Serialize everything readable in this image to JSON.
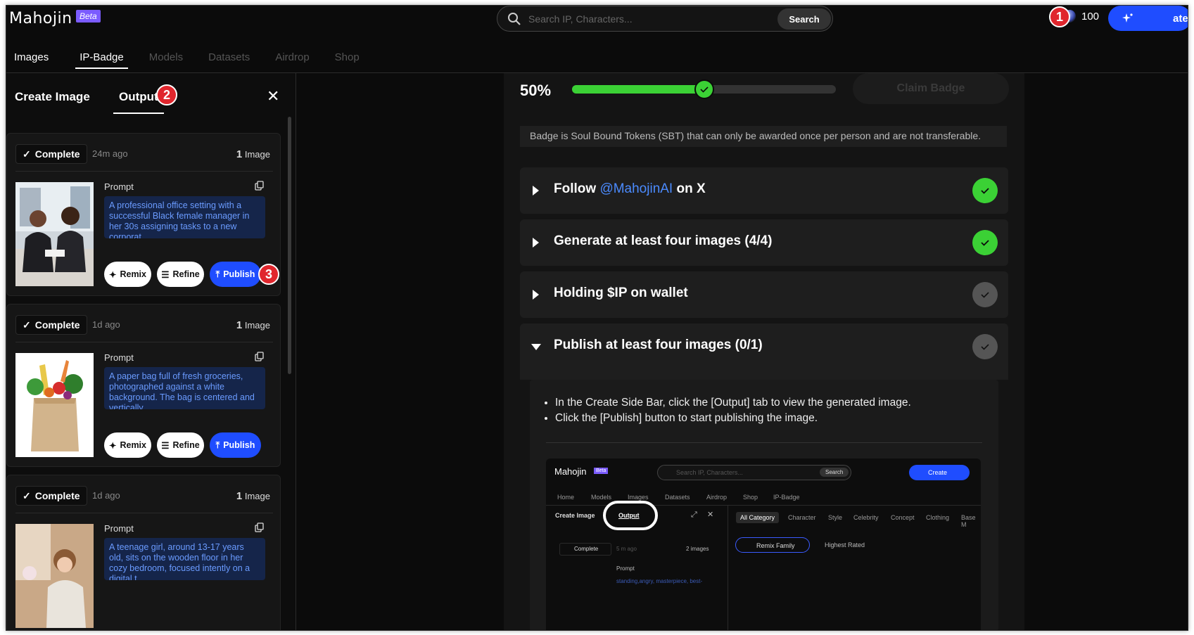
{
  "app": {
    "logo": "Mahojin",
    "beta": "Beta"
  },
  "search": {
    "placeholder": "Search IP, Characters...",
    "button": "Search"
  },
  "credits": "100",
  "create_button": "Create",
  "annotations": {
    "one": "1",
    "two": "2",
    "three": "3"
  },
  "nav": {
    "tabs": [
      {
        "label": "Images"
      },
      {
        "label": "IP-Badge"
      },
      {
        "label": "Models"
      },
      {
        "label": "Datasets"
      },
      {
        "label": "Airdrop"
      },
      {
        "label": "Shop"
      }
    ]
  },
  "sidebar": {
    "tab_create": "Create Image",
    "tab_output": "Output",
    "cards": [
      {
        "status": "Complete",
        "ago": "24m ago",
        "count_num": "1",
        "count_word": "Image",
        "prompt_label": "Prompt",
        "prompt": "A professional office setting with a successful Black female manager in her 30s assigning tasks to a new corporat...",
        "remix": "Remix",
        "refine": "Refine",
        "publish": "Publish"
      },
      {
        "status": "Complete",
        "ago": "1d ago",
        "count_num": "1",
        "count_word": "Image",
        "prompt_label": "Prompt",
        "prompt": "A paper bag full of fresh groceries, photographed against a white background. The bag is centered and vertically...",
        "remix": "Remix",
        "refine": "Refine",
        "publish": "Publish"
      },
      {
        "status": "Complete",
        "ago": "1d ago",
        "count_num": "1",
        "count_word": "Image",
        "prompt_label": "Prompt",
        "prompt": "A teenage girl, around 13-17 years old, sits on the wooden floor in her cozy bedroom, focused intently on a digital t...",
        "remix": "Remix",
        "refine": "Refine",
        "publish": "Publish"
      }
    ]
  },
  "badge": {
    "progress_label": "50%",
    "progress": 0.5,
    "claim": "Claim Badge",
    "note": "Badge is Soul Bound Tokens (SBT) that can only be awarded once per person and are not transferable.",
    "tasks": [
      {
        "prefix": "Follow ",
        "link": "@MahojinAI",
        "suffix": " on X",
        "done": true
      },
      {
        "prefix": "Generate at least four images (4/4)",
        "link": "",
        "suffix": "",
        "done": true
      },
      {
        "prefix": "Holding $IP on wallet",
        "link": "",
        "suffix": "",
        "done": false
      },
      {
        "prefix": "Publish at least four images (0/1)",
        "link": "",
        "suffix": "",
        "done": false
      }
    ],
    "instructions": [
      "In the Create Side Bar, click the [Output] tab to view the generated image.",
      "Click the [Publish] button to start publishing the image."
    ]
  },
  "mini": {
    "logo": "Mahojin",
    "beta": "Beta",
    "search_placeholder": "Search IP, Characters...",
    "search_btn": "Search",
    "create": "Create",
    "nav": [
      "Home",
      "Models",
      "Images",
      "Datasets",
      "Airdrop",
      "Shop",
      "IP-Badge"
    ],
    "create_image": "Create Image",
    "output": "Output",
    "categories": [
      "All Category",
      "Character",
      "Style",
      "Celebrity",
      "Concept",
      "Clothing",
      "Base M"
    ],
    "remix_family": "Remix Family",
    "highest_rated": "Highest Rated",
    "complete": "Complete",
    "ago": "5 m ago",
    "images": "2 images",
    "prompt": "Prompt",
    "prompt_text": "standing,angry, masterpiece, best-"
  },
  "colors": {
    "accent": "#1f4dff",
    "success": "#3bd135",
    "badge_red": "#e0262d",
    "link": "#4b8bff"
  }
}
